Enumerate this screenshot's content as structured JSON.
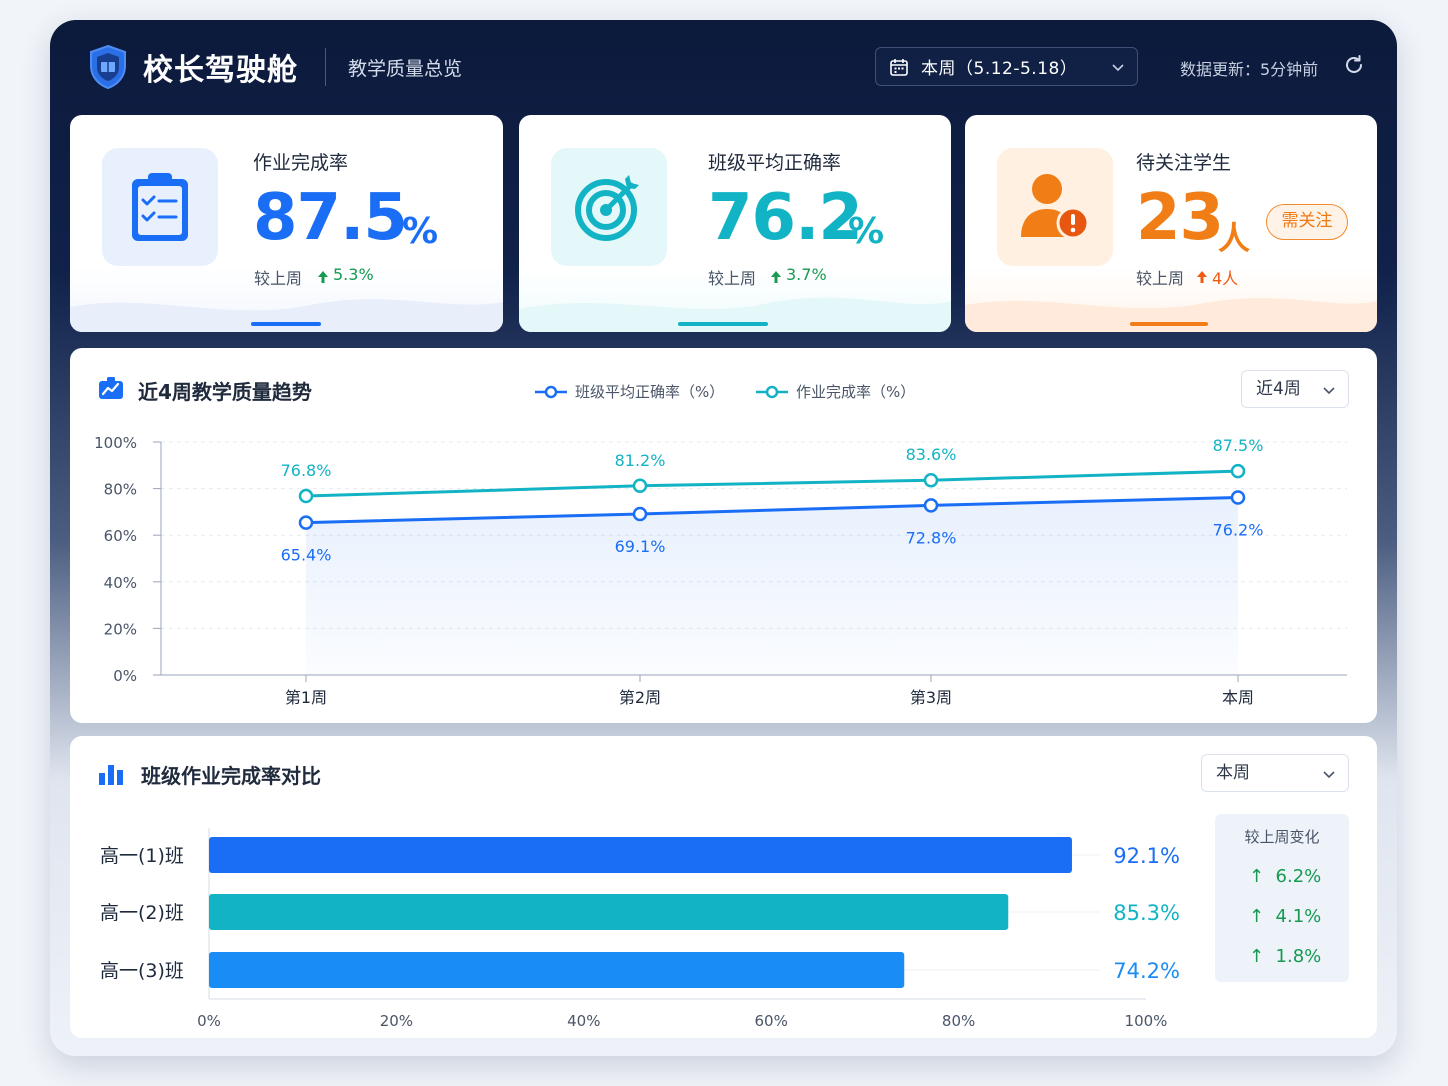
{
  "header": {
    "app_title": "校长驾驶舱",
    "subtitle": "教学质量总览",
    "week_selector": "本周（5.12-5.18）",
    "update_text": "数据更新：5分钟前"
  },
  "kpis": [
    {
      "label": "作业完成率",
      "value": "87.5",
      "unit": "%",
      "compare_label": "较上周",
      "delta": "5.3%",
      "icon": "clipboard-check-icon",
      "color": "#1a6ef5"
    },
    {
      "label": "班级平均正确率",
      "value": "76.2",
      "unit": "%",
      "compare_label": "较上周",
      "delta": "3.7%",
      "icon": "target-icon",
      "color": "#12b3c5"
    },
    {
      "label": "待关注学生",
      "value": "23",
      "unit": "人",
      "compare_label": "较上周",
      "delta": "4人",
      "badge": "需关注",
      "icon": "user-alert-icon",
      "color": "#f07d16"
    }
  ],
  "trend": {
    "title": "近4周教学质量趋势",
    "range_select": "近4周"
  },
  "class_compare": {
    "title": "班级作业完成率对比",
    "range_select": "本周",
    "change_title": "较上周变化",
    "changes": [
      "6.2%",
      "4.1%",
      "1.8%"
    ]
  },
  "chart_data": [
    {
      "type": "line",
      "categories": [
        "第1周",
        "第2周",
        "第3周",
        "本周"
      ],
      "series": [
        {
          "name": "班级平均正确率（%）",
          "values": [
            65.4,
            69.1,
            72.8,
            76.2
          ],
          "color": "#1a6ef5"
        },
        {
          "name": "作业完成率（%）",
          "values": [
            76.8,
            81.2,
            83.6,
            87.5
          ],
          "color": "#12b3c5"
        }
      ],
      "ylim": [
        0,
        100
      ],
      "yticks": [
        "0%",
        "20%",
        "40%",
        "60%",
        "80%",
        "100%"
      ],
      "grid": true,
      "legend": "top-center"
    },
    {
      "type": "bar",
      "orientation": "horizontal",
      "categories": [
        "高一(1)班",
        "高一(2)班",
        "高一(3)班"
      ],
      "values": [
        92.1,
        85.3,
        74.2
      ],
      "labels": [
        "92.1%",
        "85.3%",
        "74.2%"
      ],
      "colors": [
        "#1a6ef5",
        "#12b3c5",
        "#1a8cf5"
      ],
      "xlim": [
        0,
        100
      ],
      "xticks": [
        "0%",
        "20%",
        "40%",
        "60%",
        "80%",
        "100%"
      ]
    }
  ]
}
